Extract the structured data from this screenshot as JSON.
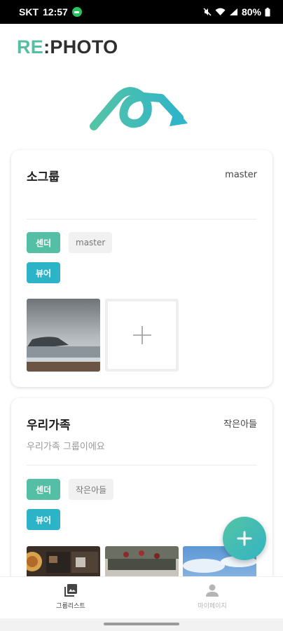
{
  "status_bar": {
    "carrier": "SKT",
    "time": "12:57",
    "battery": "80%"
  },
  "brand": {
    "prefix": "RE",
    "sep": ":",
    "suffix": "PHOTO"
  },
  "groups": [
    {
      "name": "소그룹",
      "owner": "master",
      "description": "",
      "sender_label": "센더",
      "sender_name": "master",
      "viewer_label": "뷰어"
    },
    {
      "name": "우리가족",
      "owner": "작은아들",
      "description": "우리가족 그룹이에요",
      "sender_label": "센더",
      "sender_name": "작은아들",
      "viewer_label": "뷰어"
    }
  ],
  "bottom_nav": {
    "group_list": "그룹리스트",
    "my_page": "마이페이지"
  },
  "colors": {
    "brand_green": "#55bfa6",
    "brand_teal": "#2db3c8"
  },
  "icons": {
    "fab": "plus-icon",
    "nav_group_list": "gallery-icon",
    "nav_my_page": "person-icon"
  }
}
